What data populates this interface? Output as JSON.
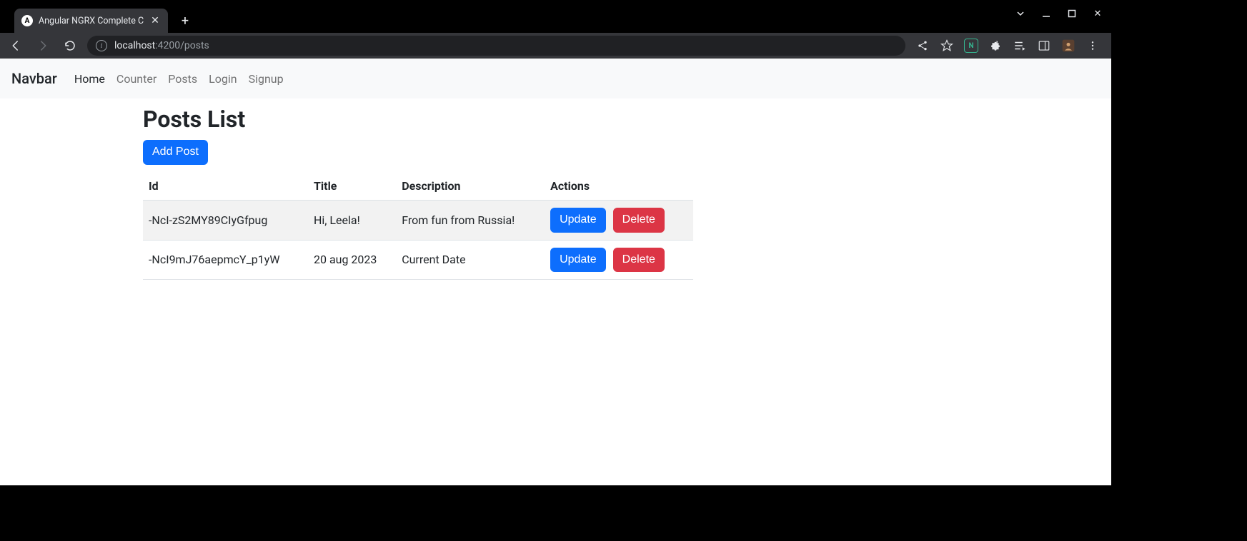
{
  "browser": {
    "tab_title": "Angular NGRX Complete C",
    "url_host": "localhost",
    "url_port_path": ":4200/posts"
  },
  "navbar": {
    "brand": "Navbar",
    "links": [
      {
        "label": "Home",
        "active": true
      },
      {
        "label": "Counter",
        "active": false
      },
      {
        "label": "Posts",
        "active": false
      },
      {
        "label": "Login",
        "active": false
      },
      {
        "label": "Signup",
        "active": false
      }
    ]
  },
  "page": {
    "title": "Posts List",
    "add_button": "Add Post",
    "table": {
      "headers": {
        "id": "Id",
        "title": "Title",
        "description": "Description",
        "actions": "Actions"
      },
      "update_label": "Update",
      "delete_label": "Delete",
      "rows": [
        {
          "id": "-NcI-zS2MY89CIyGfpug",
          "title": "Hi, Leela!",
          "description": "From fun from Russia!"
        },
        {
          "id": "-NcI9mJ76aepmcY_p1yW",
          "title": "20 aug 2023",
          "description": "Current Date"
        }
      ]
    }
  }
}
